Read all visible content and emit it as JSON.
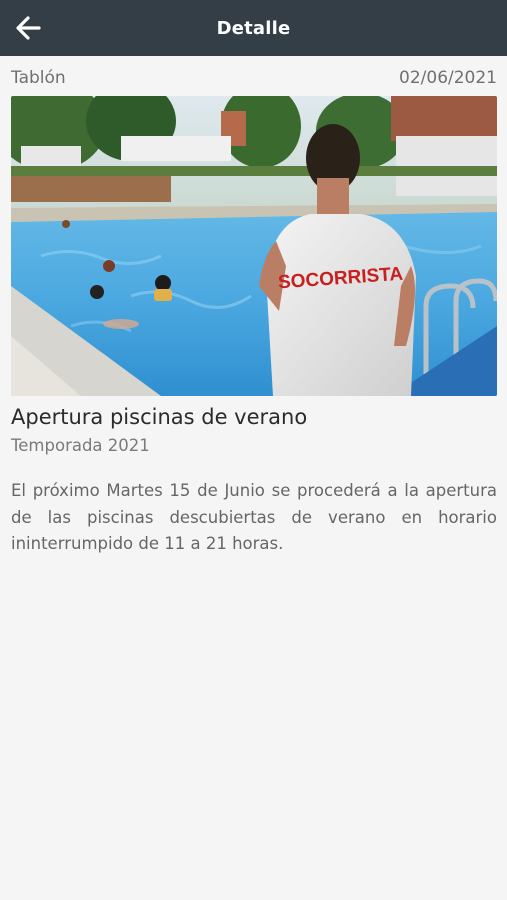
{
  "header": {
    "title": "Detalle",
    "back_icon": "arrow-left-icon"
  },
  "post": {
    "category": "Tablón",
    "date": "02/06/2021",
    "image_alt": "Socorrista junto a la piscina descubierta de verano",
    "shirt_text": "SOCORRISTA",
    "title": "Apertura piscinas de verano",
    "subtitle": "Temporada 2021",
    "body": "El próximo Martes 15 de Junio se procederá a la apertura de las piscinas descubiertas de verano en horario ininterrumpido de 11 a 21 horas."
  },
  "colors": {
    "header_bg": "#343e47",
    "page_bg": "#f5f5f5",
    "pool_water": "#4aa7df"
  }
}
